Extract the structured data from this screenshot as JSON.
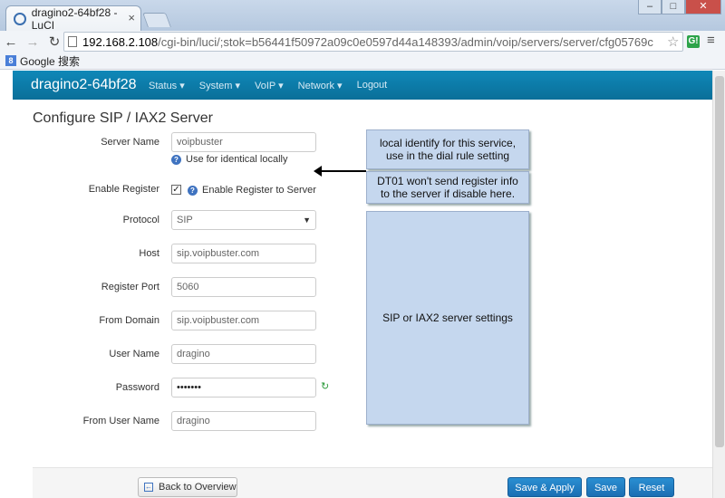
{
  "browser": {
    "tab_title": "dragino2-64bf28 - LuCI",
    "tab_close": "×",
    "window_controls": [
      "–",
      "□",
      "✕"
    ],
    "url_host": "192.168.2.108",
    "url_path": "/cgi-bin/luci/;stok=b56441f50972a09c0e0597d44a148393/admin/voip/servers/server/cfg05769c",
    "bookmark_label": "Google 搜索",
    "ext_label": "G!"
  },
  "navbar": {
    "brand": "dragino2-64bf28",
    "items": [
      "Status ▾",
      "System ▾",
      "VoIP ▾",
      "Network ▾",
      "Logout"
    ]
  },
  "form": {
    "title": "Configure SIP / IAX2 Server",
    "server_name": {
      "label": "Server Name",
      "value": "voipbuster",
      "hint": "Use for identical locally"
    },
    "enable_register": {
      "label": "Enable Register",
      "checked": true,
      "hint": "Enable Register to Server"
    },
    "protocol": {
      "label": "Protocol",
      "value": "SIP"
    },
    "host": {
      "label": "Host",
      "value": "sip.voipbuster.com"
    },
    "register_port": {
      "label": "Register Port",
      "value": "5060"
    },
    "from_domain": {
      "label": "From Domain",
      "value": "sip.voipbuster.com"
    },
    "user_name": {
      "label": "User Name",
      "value": "dragino"
    },
    "password": {
      "label": "Password",
      "value": "•••••••"
    },
    "from_user_name": {
      "label": "From User Name",
      "value": "dragino"
    }
  },
  "callouts": {
    "server_name_note": "local identify for this service, use in the dial rule setting",
    "register_note": "DT01 won't send register info to the server if disable here.",
    "settings_note": "SIP or IAX2 server settings"
  },
  "footer": {
    "back": "Back to Overview",
    "save_apply": "Save & Apply",
    "save": "Save",
    "reset": "Reset"
  },
  "colors": {
    "navbar": "#0a7bab",
    "primary_button": "#1f79bf",
    "callout": "#c5d7ee"
  }
}
